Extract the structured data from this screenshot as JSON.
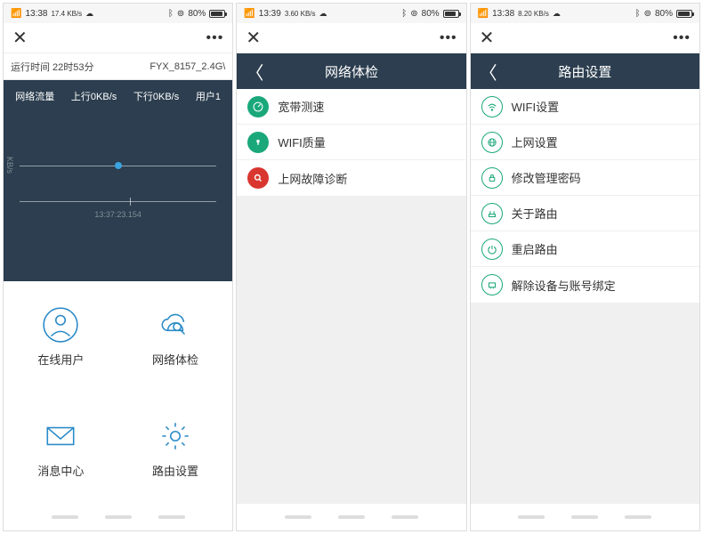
{
  "s1": {
    "time": "13:38",
    "speed": "17.4 KB/s",
    "battery": "80%",
    "runtime_label": "运行时间 22时53分",
    "ssid": "FYX_8157_2.4G\\",
    "metric_flow": "网络流量",
    "metric_up": "上行0KB/s",
    "metric_down": "下行0KB/s",
    "metric_user": "用户1",
    "y_axis": "KB/s",
    "timestamp": "13:37:23.154",
    "btn_users": "在线用户",
    "btn_netcheck": "网络体检",
    "btn_msgs": "消息中心",
    "btn_settings": "路由设置"
  },
  "s2": {
    "time": "13:39",
    "speed": "3.60 KB/s",
    "battery": "80%",
    "title": "网络体检",
    "items": [
      "宽带测速",
      "WIFI质量",
      "上网故障诊断"
    ]
  },
  "s3": {
    "time": "13:38",
    "speed": "8.20 KB/s",
    "battery": "80%",
    "title": "路由设置",
    "items": [
      "WIFI设置",
      "上网设置",
      "修改管理密码",
      "关于路由",
      "重启路由",
      "解除设备与账号绑定"
    ]
  }
}
